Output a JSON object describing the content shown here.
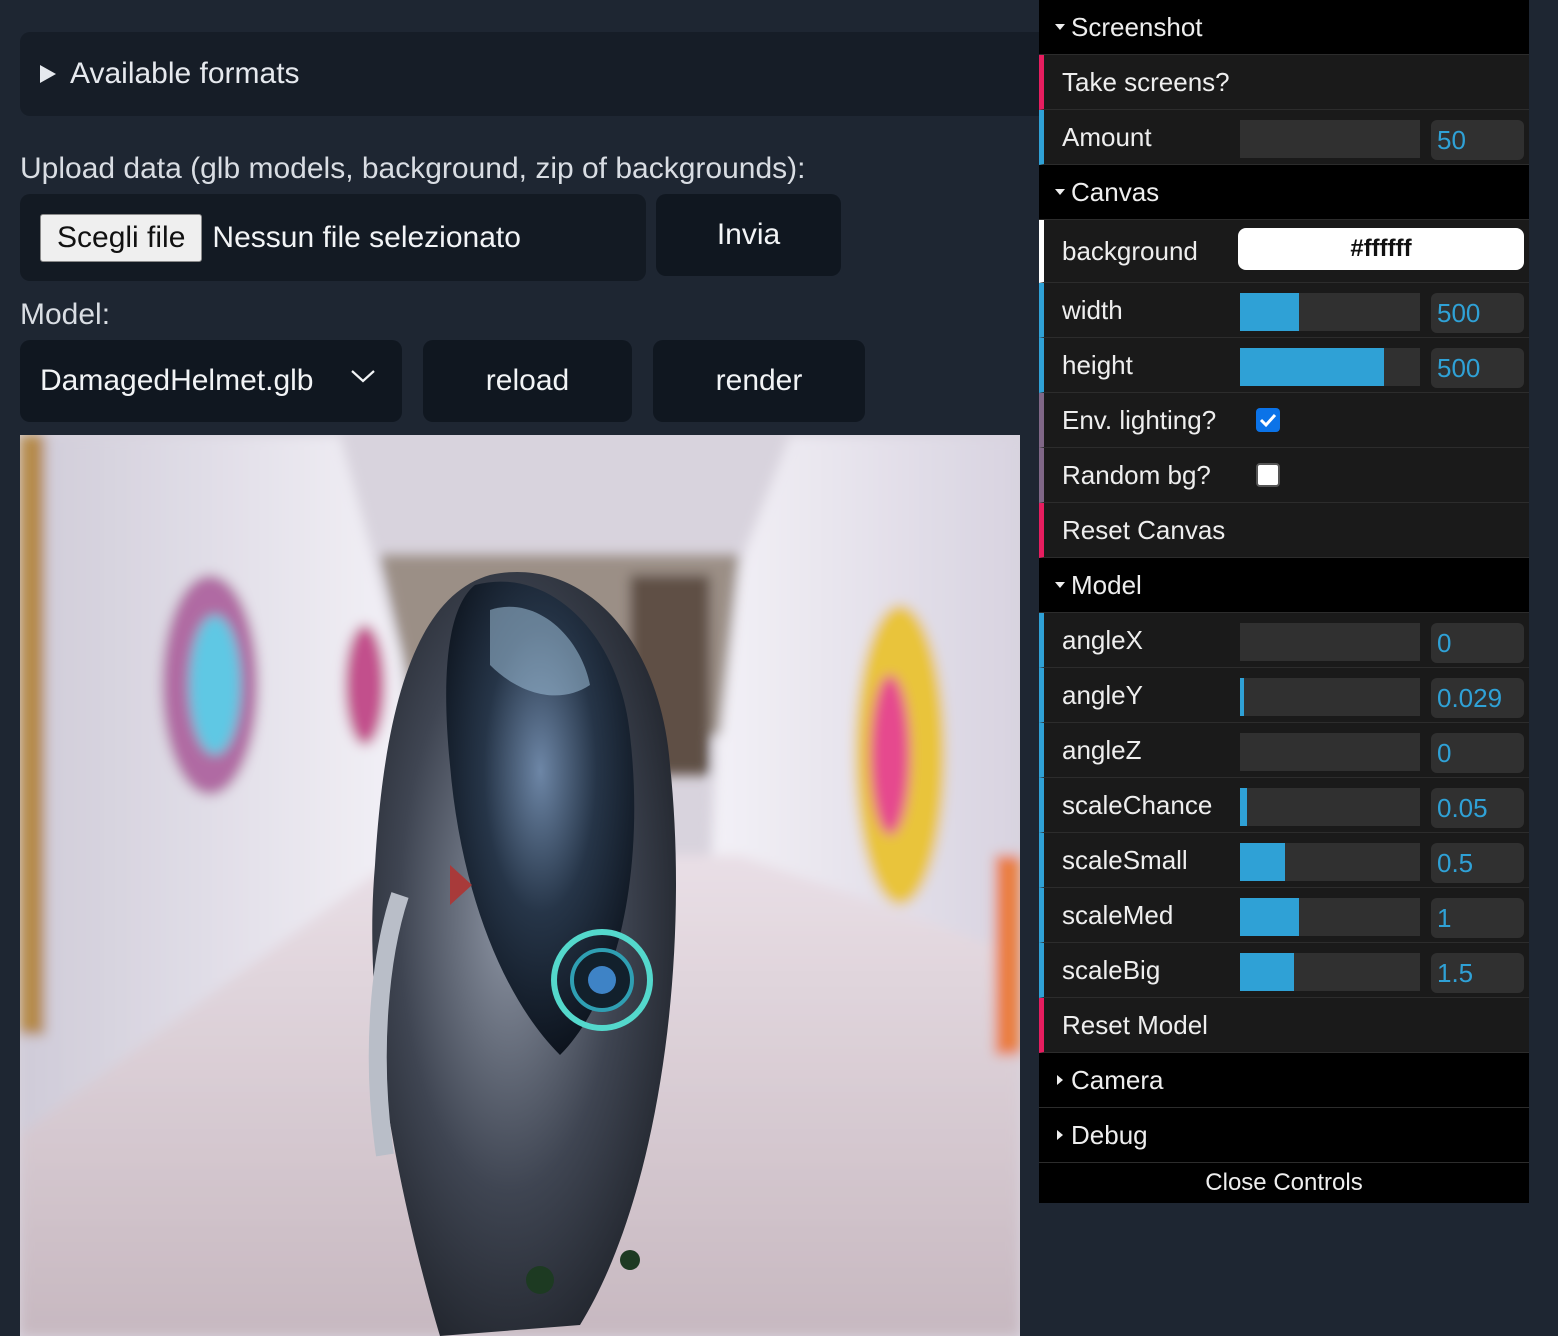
{
  "page": {
    "formats_summary": "Available formats",
    "upload_label": "Upload data (glb models, background, zip of backgrounds):",
    "file_button": "Scegli file",
    "file_status": "Nessun file selezionato",
    "submit_button": "Invia",
    "model_label": "Model:",
    "model_select": "DamagedHelmet.glb",
    "reload_button": "reload",
    "render_button": "render"
  },
  "gui": {
    "screenshot": {
      "title": "Screenshot",
      "take_screens": "Take screens?",
      "amount_label": "Amount",
      "amount_value": "50",
      "amount_fill": 0
    },
    "canvas": {
      "title": "Canvas",
      "background_label": "background",
      "background_value": "#ffffff",
      "width_label": "width",
      "width_value": "500",
      "width_fill": 0.33,
      "height_label": "height",
      "height_value": "500",
      "height_fill": 0.8,
      "env_lighting_label": "Env. lighting?",
      "env_lighting": true,
      "random_bg_label": "Random bg?",
      "random_bg": false,
      "reset_label": "Reset Canvas"
    },
    "model": {
      "title": "Model",
      "params": [
        {
          "label": "angleX",
          "value": "0",
          "fill": 0
        },
        {
          "label": "angleY",
          "value": "0.029",
          "fill": 0.02
        },
        {
          "label": "angleZ",
          "value": "0",
          "fill": 0
        },
        {
          "label": "scaleChance",
          "value": "0.05",
          "fill": 0.04
        },
        {
          "label": "scaleSmall",
          "value": "0.5",
          "fill": 0.25
        },
        {
          "label": "scaleMed",
          "value": "1",
          "fill": 0.33
        },
        {
          "label": "scaleBig",
          "value": "1.5",
          "fill": 0.3
        }
      ],
      "reset_label": "Reset Model"
    },
    "camera": {
      "title": "Camera"
    },
    "debug": {
      "title": "Debug"
    },
    "close_label": "Close Controls"
  },
  "colors": {
    "page_bg": "#1e2632",
    "accent_blue": "#2fa1d6",
    "button_accent": "#e61d5f",
    "boolean_accent": "#806787"
  }
}
